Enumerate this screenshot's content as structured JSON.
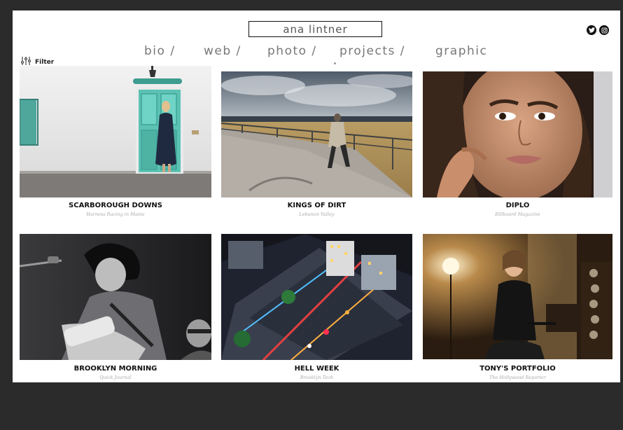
{
  "header": {
    "title": "ana lintner"
  },
  "social": {
    "twitter_icon": "twitter-icon",
    "instagram_icon": "instagram-icon"
  },
  "nav": {
    "items": [
      {
        "label": "bio /"
      },
      {
        "label": "web /"
      },
      {
        "label": "photo /"
      },
      {
        "label": "projects /"
      },
      {
        "label": "graphic"
      }
    ]
  },
  "filter": {
    "label": "Filter",
    "icon": "sliders-icon"
  },
  "projects": [
    {
      "title": "SCARBOROUGH DOWNS",
      "client": "Harness Racing in Maine"
    },
    {
      "title": "KINGS OF DIRT",
      "client": "Lebanon Valley"
    },
    {
      "title": "DIPLO",
      "client": "Billboard Magazine"
    },
    {
      "title": "BROOKLYN MORNING",
      "client": "Quick Journal"
    },
    {
      "title": "HELL WEEK",
      "client": "Brooklyn Tech"
    },
    {
      "title": "TONY'S PORTFOLIO",
      "client": "The Hollywood Reporter"
    }
  ]
}
